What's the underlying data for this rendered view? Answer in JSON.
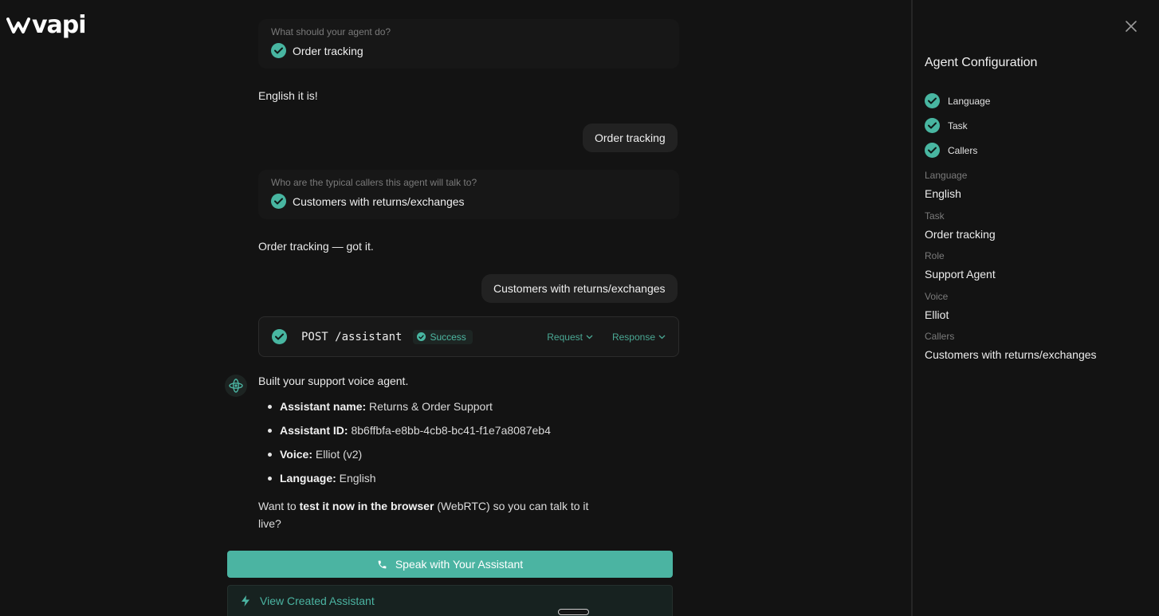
{
  "brand": {
    "logo_text": "vapi"
  },
  "chat": {
    "question_task": {
      "label": "What should your agent do?",
      "answer": "Order tracking"
    },
    "reply_language": "English it is!",
    "user_task": "Order tracking",
    "question_callers": {
      "label": "Who are the typical callers this agent will talk to?",
      "answer": "Customers with returns/exchanges"
    },
    "reply_task": "Order tracking — got it.",
    "user_callers": "Customers with returns/exchanges",
    "api_call": {
      "method": "POST /assistant",
      "status": "Success",
      "request_label": "Request",
      "response_label": "Response"
    },
    "response": {
      "intro": "Built your support voice agent.",
      "items": [
        {
          "key": "Assistant name:",
          "value": "Returns & Order Support"
        },
        {
          "key": "Assistant ID:",
          "value": "8b6ffbfa-e8bb-4cb8-bc41-f1e7a8087eb4"
        },
        {
          "key": "Voice:",
          "value": "Elliot (v2)"
        },
        {
          "key": "Language:",
          "value": "English"
        }
      ],
      "question_prefix": "Want to",
      "question_bold": "test it now in the browser",
      "question_suffix": "(WebRTC) so you can talk to it live?"
    },
    "speak_button": "Speak with Your Assistant",
    "view_button": "View Created Assistant"
  },
  "panel": {
    "title": "Agent Configuration",
    "steps": [
      "Language",
      "Task",
      "Callers"
    ],
    "fields": [
      {
        "key": "Language",
        "value": "English"
      },
      {
        "key": "Task",
        "value": "Order tracking"
      },
      {
        "key": "Role",
        "value": "Support Agent"
      },
      {
        "key": "Voice",
        "value": "Elliot"
      },
      {
        "key": "Callers",
        "value": "Customers with returns/exchanges"
      }
    ]
  },
  "colors": {
    "accent": "#4bb4a2",
    "background": "#131313",
    "card": "#171717",
    "bubble": "#222222"
  }
}
